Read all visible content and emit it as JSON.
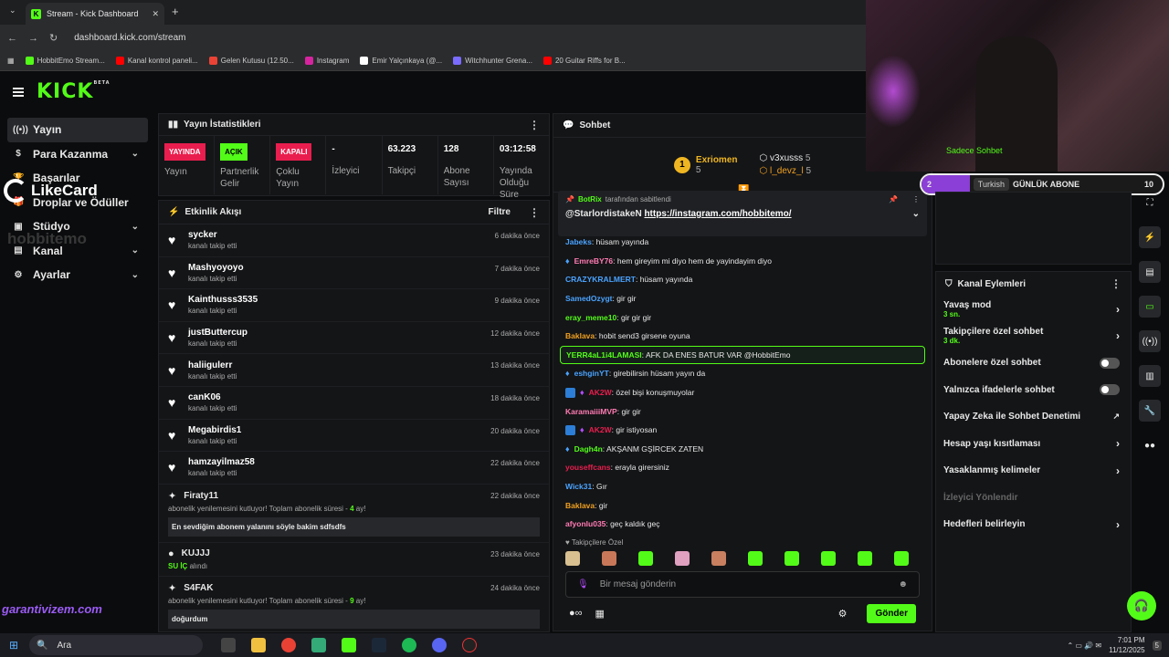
{
  "browser": {
    "tab_title": "Stream - Kick Dashboard",
    "url": "dashboard.kick.com/stream",
    "bookmarks": [
      {
        "label": "HobbitEmo Stream...",
        "color": "#53fc18"
      },
      {
        "label": "Kanal kontrol paneli...",
        "color": "#ff0000"
      },
      {
        "label": "Gelen Kutusu (12.50...",
        "color": "#ea4335"
      },
      {
        "label": "Instagram",
        "color": "#d6249f"
      },
      {
        "label": "Emir Yalçınkaya (@...",
        "color": "#ffffff"
      },
      {
        "label": "Witchhunter Grena...",
        "color": "#7a6cff"
      },
      {
        "label": "20 Guitar Riffs for B...",
        "color": "#ff0000"
      }
    ]
  },
  "sidebar": {
    "items": [
      {
        "label": "Yayın",
        "icon": "broadcast-icon"
      },
      {
        "label": "Para Kazanma",
        "icon": "money-icon"
      },
      {
        "label": "Başarılar",
        "icon": "trophy-icon"
      },
      {
        "label": "Droplar ve Ödüller",
        "icon": "gift-icon"
      },
      {
        "label": "Stüdyo",
        "icon": "studio-icon"
      },
      {
        "label": "Kanal",
        "icon": "channel-icon"
      },
      {
        "label": "Ayarlar",
        "icon": "gear-icon"
      }
    ]
  },
  "stats": {
    "title": "Yayın İstatistikleri",
    "items": [
      {
        "badge": "YAYINDA",
        "badge_color": "#e91e4e",
        "label": "Yayın"
      },
      {
        "badge": "AÇIK",
        "badge_color": "#53fc18",
        "label": "Partnerlik Gelir"
      },
      {
        "badge": "KAPALI",
        "badge_color": "#e91e4e",
        "label": "Çoklu Yayın"
      },
      {
        "value": "-",
        "label": "İzleyici"
      },
      {
        "value": "63.223",
        "label": "Takipçi"
      },
      {
        "value": "128",
        "label": "Abone Sayısı"
      },
      {
        "value": "03:12:58",
        "label": "Yayında Olduğu Süre"
      }
    ]
  },
  "activity": {
    "title": "Etkinlik Akışı",
    "filter": "Filtre",
    "follows": [
      {
        "name": "sycker",
        "sub": "kanalı takip etti",
        "time": "6 dakika önce"
      },
      {
        "name": "Mashyoyoyo",
        "sub": "kanalı takip etti",
        "time": "7 dakika önce"
      },
      {
        "name": "Kainthusss3535",
        "sub": "kanalı takip etti",
        "time": "9 dakika önce"
      },
      {
        "name": "justButtercup",
        "sub": "kanalı takip etti",
        "time": "12 dakika önce"
      },
      {
        "name": "haliigulerr",
        "sub": "kanalı takip etti",
        "time": "13 dakika önce"
      },
      {
        "name": "canK06",
        "sub": "kanalı takip etti",
        "time": "18 dakika önce"
      },
      {
        "name": "Megabirdis1",
        "sub": "kanalı takip etti",
        "time": "20 dakika önce"
      },
      {
        "name": "hamzayilmaz58",
        "sub": "kanalı takip etti",
        "time": "22 dakika önce"
      }
    ],
    "resub1": {
      "name": "Firaty11",
      "time": "22 dakika önce",
      "text": "abonelik yenilemesini kutluyor! Toplam abonelik süresi - ",
      "count": "4",
      "unit": " ay!",
      "quote": "En sevdiğim abonem yalanını söyle bakim sdfsdfs"
    },
    "reward": {
      "name": "KUJJJ",
      "time": "23 dakika önce",
      "item": "SU İÇ",
      "suffix": " alındı"
    },
    "resub2": {
      "name": "S4FAK",
      "time": "24 dakika önce",
      "text": "abonelik yenilemesini kutluyor! Toplam abonelik süresi - ",
      "count": "9",
      "unit": " ay!",
      "quote": "doğurdum"
    }
  },
  "chat": {
    "title": "Sohbet",
    "leaders": [
      {
        "rank": "1",
        "name": "Exriomen",
        "count": "5"
      },
      {
        "name": "v3xusss",
        "count": "5"
      },
      {
        "name": "l_devz_l",
        "count": "5"
      }
    ],
    "pinned": {
      "by": "BotRix",
      "by_suffix": " tarafından sabitlendi",
      "user": "@StarlordistakeN",
      "link": "https://instagram.com/hobbitemo/"
    },
    "messages": [
      {
        "user": "Jabeks",
        "color": "#4aa3ff",
        "text": "hüsam yayında"
      },
      {
        "user": "EmreBY76",
        "color": "#ff7bb3",
        "text": "hem gireyim mi diyo hem de yayindayim diyo",
        "drop": true
      },
      {
        "user": "CRAZYKRALMERT",
        "color": "#4aa3ff",
        "text": "hüsam yayında"
      },
      {
        "user": "SamedOzygt",
        "color": "#4aa3ff",
        "text": "gir gir"
      },
      {
        "user": "eray_meme10",
        "color": "#53fc18",
        "text": "gir gir gir"
      },
      {
        "user": "Baklava",
        "color": "#f0a020",
        "text": "hobit send3 girsene oyuna"
      },
      {
        "user": "YERR4aL1i4LAMASI",
        "color": "#53fc18",
        "text": "AFK DA ENES BATUR VAR @HobbitEmo",
        "highlight": true
      },
      {
        "user": "eshginYT",
        "color": "#4aa3ff",
        "text": "girebilirsin hüsam yayın da",
        "drop": true
      },
      {
        "user": "AK2W",
        "color": "#e91e4e",
        "text": "özel bişi konuşmuyolar",
        "badge": true
      },
      {
        "user": "KaramaiiiMVP",
        "color": "#ff7bb3",
        "text": "gir gir"
      },
      {
        "user": "AK2W",
        "color": "#e91e4e",
        "text": "gir istiyosan",
        "badge": true
      },
      {
        "user": "Dagh4n",
        "color": "#53fc18",
        "text": "AKŞANM GŞİRCEK ZATEN",
        "drop": true
      },
      {
        "user": "youseffcans",
        "color": "#e91e4e",
        "text": "erayla girersiniz"
      },
      {
        "user": "Wick31",
        "color": "#4aa3ff",
        "text": "Gır"
      },
      {
        "user": "Baklava",
        "color": "#f0a020",
        "text": "gir"
      },
      {
        "user": "afyonlu035",
        "color": "#ff7bb3",
        "text": "geç kaldık geç"
      }
    ],
    "emotes_label": "Takipçilere Özel",
    "emote_colors": [
      "#d8c090",
      "#c87858",
      "#53fc18",
      "#e0a0c0",
      "#c88060",
      "#53fc18",
      "#53fc18",
      "#53fc18",
      "#53fc18",
      "#53fc18"
    ],
    "placeholder": "Bir mesaj gönderin",
    "send": "Gönder"
  },
  "goal": {
    "number": "2",
    "language": "Turkish",
    "label": "GÜNLÜK ABONE",
    "target": "10",
    "progress": 0.2,
    "above": "Sadece Sohbet"
  },
  "channel_actions": {
    "title": "Kanal Eylemleri",
    "items": [
      {
        "label": "Yavaş mod",
        "sub": "3 sn.",
        "type": "chevron"
      },
      {
        "label": "Takipçilere özel sohbet",
        "sub": "3 dk.",
        "type": "chevron"
      },
      {
        "label": "Abonelere özel sohbet",
        "type": "toggle"
      },
      {
        "label": "Yalnızca ifadelerle sohbet",
        "type": "toggle"
      },
      {
        "label": "Yapay Zeka ile Sohbet Denetimi",
        "type": "external"
      },
      {
        "label": "Hesap yaşı kısıtlaması",
        "type": "chevron"
      },
      {
        "label": "Yasaklanmış kelimeler",
        "type": "chevron"
      },
      {
        "label": "İzleyici Yönlendir",
        "type": "disabled"
      },
      {
        "label": "Hedefleri belirleyin",
        "type": "chevron"
      }
    ]
  },
  "overlays": {
    "likecard": "LikeCard",
    "hobbit": "hobbitemo",
    "garanti": "garantivizem.com"
  },
  "taskbar": {
    "search": "Ara",
    "time": "7:01 PM",
    "date": "11/12/2025",
    "notif": "5"
  }
}
